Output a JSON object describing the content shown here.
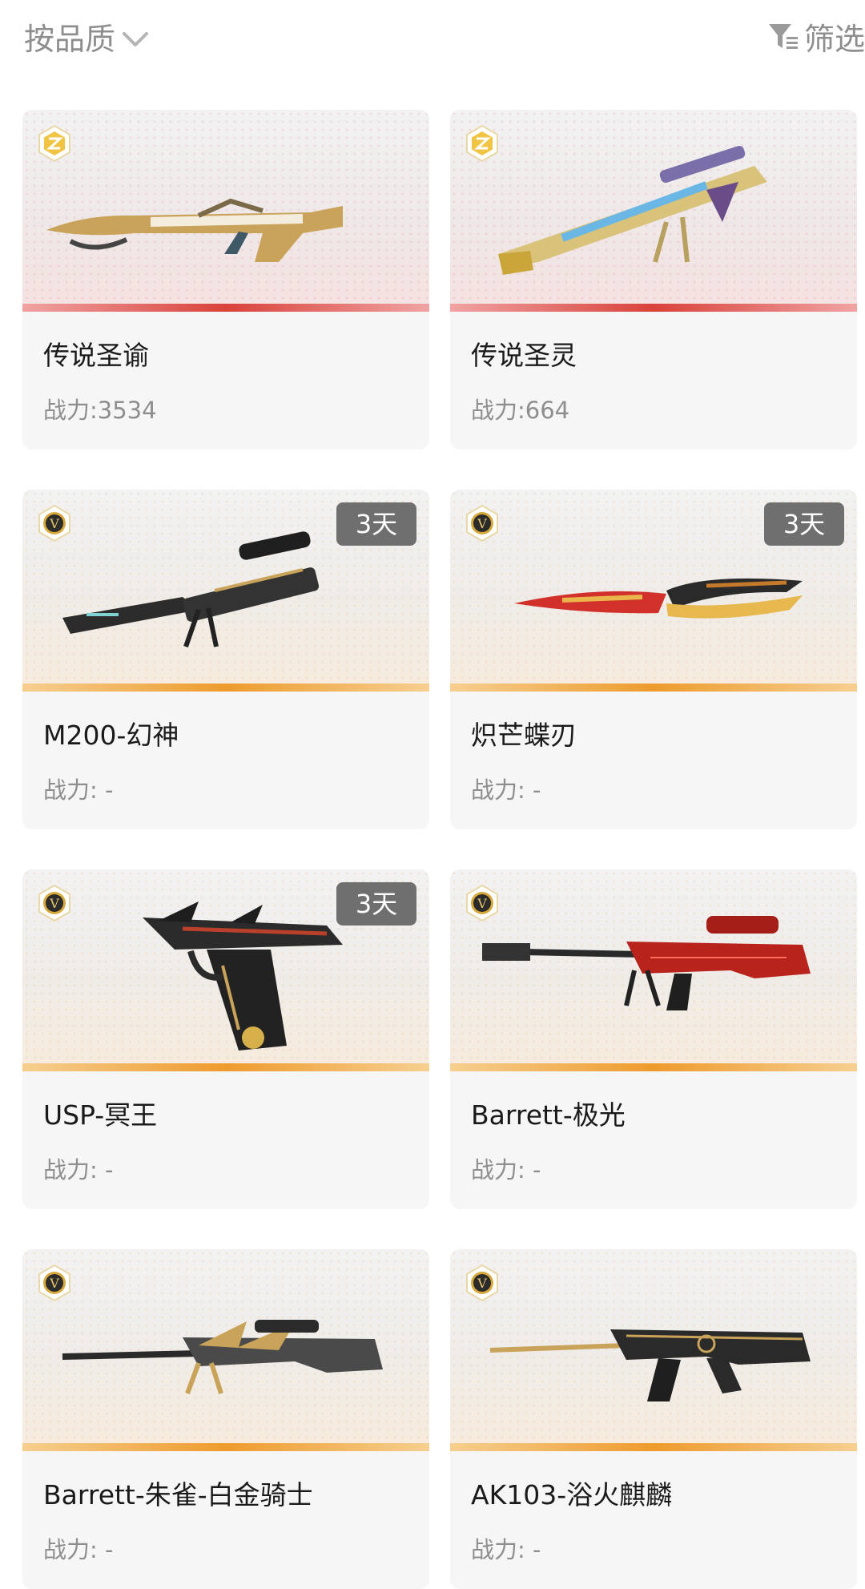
{
  "header": {
    "sort_label": "按品质",
    "filter_label": "筛选"
  },
  "items": [
    {
      "name": "传说圣谕",
      "power": "战力:3534",
      "quality": "legendary",
      "days": ""
    },
    {
      "name": "传说圣灵",
      "power": "战力:664",
      "quality": "legendary",
      "days": ""
    },
    {
      "name": "M200-幻神",
      "power": "战力: -",
      "quality": "epic",
      "days": "3天"
    },
    {
      "name": "炽芒蝶刃",
      "power": "战力: -",
      "quality": "epic",
      "days": "3天"
    },
    {
      "name": "USP-冥王",
      "power": "战力: -",
      "quality": "epic",
      "days": "3天"
    },
    {
      "name": "Barrett-极光",
      "power": "战力: -",
      "quality": "epic",
      "days": ""
    },
    {
      "name": "Barrett-朱雀-白金骑士",
      "power": "战力: -",
      "quality": "epic",
      "days": ""
    },
    {
      "name": "AK103-浴火麒麟",
      "power": "战力: -",
      "quality": "epic",
      "days": ""
    }
  ],
  "badges": {
    "legendary_letter": "",
    "epic_letter": "V"
  },
  "colors": {
    "legendary_stripe": "#d9423a",
    "epic_stripe": "#ee9b2d",
    "days_badge_bg": "#6f6f6f",
    "secondary_text": "#8e8e8e"
  }
}
